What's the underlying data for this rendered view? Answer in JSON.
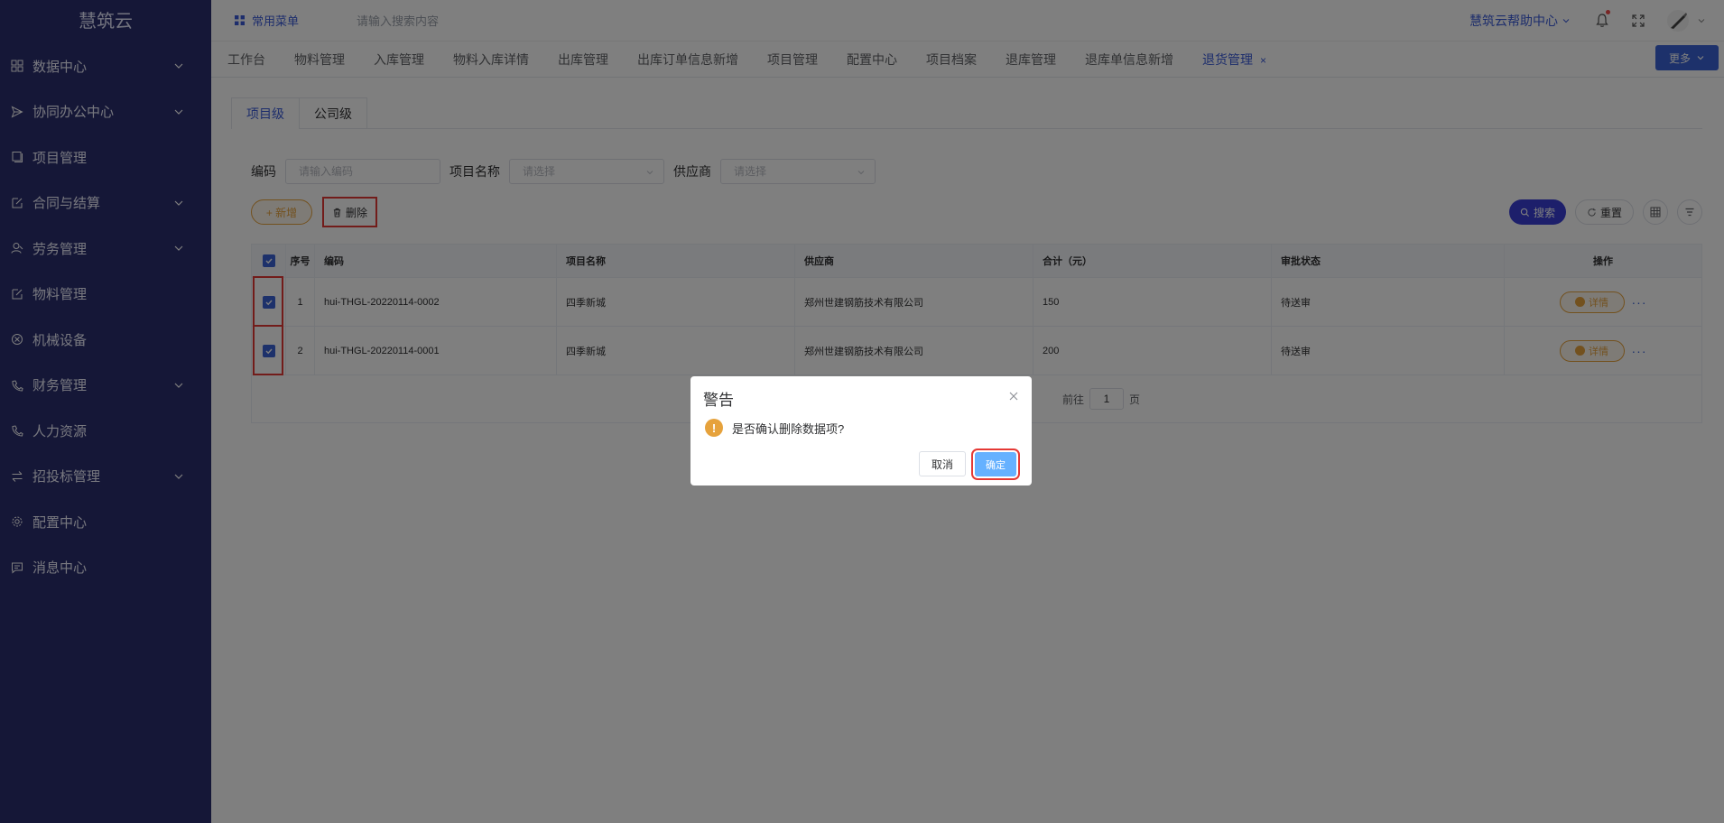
{
  "app": {
    "logo": "慧筑云"
  },
  "sidebar": {
    "items": [
      {
        "label": "数据中心",
        "icon": "grid-icon",
        "expandable": true
      },
      {
        "label": "协同办公中心",
        "icon": "send-icon",
        "expandable": true
      },
      {
        "label": "项目管理",
        "icon": "book-icon",
        "expandable": false
      },
      {
        "label": "合同与结算",
        "icon": "edit-icon",
        "expandable": true
      },
      {
        "label": "劳务管理",
        "icon": "user-icon",
        "expandable": true
      },
      {
        "label": "物料管理",
        "icon": "edit-icon",
        "expandable": false
      },
      {
        "label": "机械设备",
        "icon": "cancel-circle-icon",
        "expandable": false
      },
      {
        "label": "财务管理",
        "icon": "phone-icon",
        "expandable": true
      },
      {
        "label": "人力资源",
        "icon": "phone-icon",
        "expandable": false
      },
      {
        "label": "招投标管理",
        "icon": "swap-icon",
        "expandable": true
      },
      {
        "label": "配置中心",
        "icon": "gear-icon",
        "expandable": false
      },
      {
        "label": "消息中心",
        "icon": "message-icon",
        "expandable": false
      }
    ]
  },
  "header": {
    "favorites": "常用菜单",
    "search_placeholder": "请输入搜索内容",
    "help": "慧筑云帮助中心"
  },
  "tabs": {
    "items": [
      "工作台",
      "物料管理",
      "入库管理",
      "物料入库详情",
      "出库管理",
      "出库订单信息新增",
      "项目管理",
      "配置中心",
      "项目档案",
      "退库管理",
      "退库单信息新增",
      "退货管理"
    ],
    "active": "退货管理",
    "close_symbol": "×",
    "more": "更多"
  },
  "level_tabs": [
    "项目级",
    "公司级"
  ],
  "filters": {
    "code_label": "编码",
    "code_placeholder": "请输入编码",
    "project_label": "项目名称",
    "project_placeholder": "请选择",
    "supplier_label": "供应商",
    "supplier_placeholder": "请选择"
  },
  "toolbar": {
    "add": "+ 新增",
    "delete": "删除",
    "search": "搜索",
    "reset": "重置"
  },
  "table": {
    "headers": [
      "序号",
      "编码",
      "项目名称",
      "供应商",
      "合计（元）",
      "审批状态",
      "操作"
    ],
    "rows": [
      {
        "no": "1",
        "code": "hui-THGL-20220114-0002",
        "project": "四季新城",
        "supplier": "郑州世建钢筋技术有限公司",
        "total": "150",
        "status": "待送审",
        "action": "详情"
      },
      {
        "no": "2",
        "code": "hui-THGL-20220114-0001",
        "project": "四季新城",
        "supplier": "郑州世建钢筋技术有限公司",
        "total": "200",
        "status": "待送审",
        "action": "详情"
      }
    ]
  },
  "pager": {
    "goto": "前往",
    "page": "1",
    "page_suffix": "页"
  },
  "dialog": {
    "title": "警告",
    "message": "是否确认删除数据项?",
    "warn_symbol": "!",
    "cancel": "取消",
    "ok": "确定"
  },
  "colors": {
    "sidebar": "#2b2f6e",
    "primary": "#3a63d6",
    "warning": "#e6a23c",
    "highlight": "#e53935"
  }
}
